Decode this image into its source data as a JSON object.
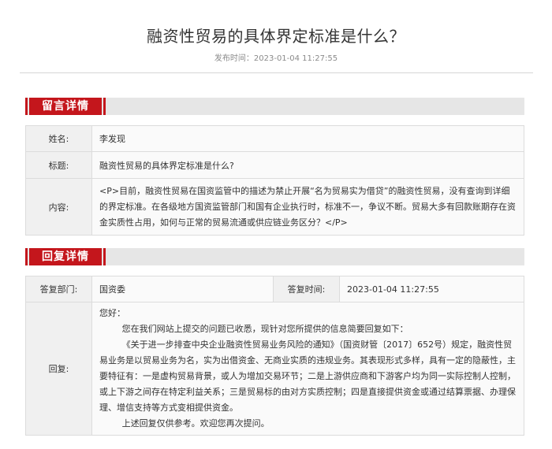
{
  "header": {
    "title": "融资性贸易的具体界定标准是什么？",
    "publish_label": "发布时间：",
    "publish_time": "2023-01-04 11:27:55"
  },
  "message": {
    "section_title": "留言详情",
    "name_label": "姓名:",
    "name_value": "李发现",
    "title_label": "标题:",
    "title_value": "融资性贸易的具体界定标准是什么?",
    "content_label": "内容:",
    "content_value": "<P>目前，融资性贸易在国资监管中的描述为禁止开展“名为贸易实为借贷”的融资性贸易，没有查询到详细的界定标准。在各级地方国资监管部门和国有企业执行时，标准不一，争议不断。贸易大多有回款账期存在资金实质性占用，如何与正常的贸易流通或供应链业务区分？</P>"
  },
  "reply": {
    "section_title": "回复详情",
    "dept_label": "答复部门:",
    "dept_value": "国资委",
    "time_label": "答复时间:",
    "time_value": "2023-01-04 11:27:55",
    "reply_label": "回复:",
    "greeting": "您好：",
    "para1": "您在我们网站上提交的问题已收悉，现针对您所提供的信息简要回复如下：",
    "para2": "《关于进一步排查中央企业融资性贸易业务风险的通知》（国资财管〔2017〕652号）规定，融资性贸易业务是以贸易业务为名，实为出借资金、无商业实质的违规业务。其表现形式多样，具有一定的隐蔽性，主要特征有：一是虚构贸易背景，或人为增加交易环节；二是上游供应商和下游客户均为同一实际控制人控制，或上下游之间存在特定利益关系；三是贸易标的由对方实质控制；四是直接提供资金或通过结算票据、办理保理、增信支持等方式变相提供资金。",
    "para3": "上述回复仅供参考。欢迎您再次提问。"
  }
}
